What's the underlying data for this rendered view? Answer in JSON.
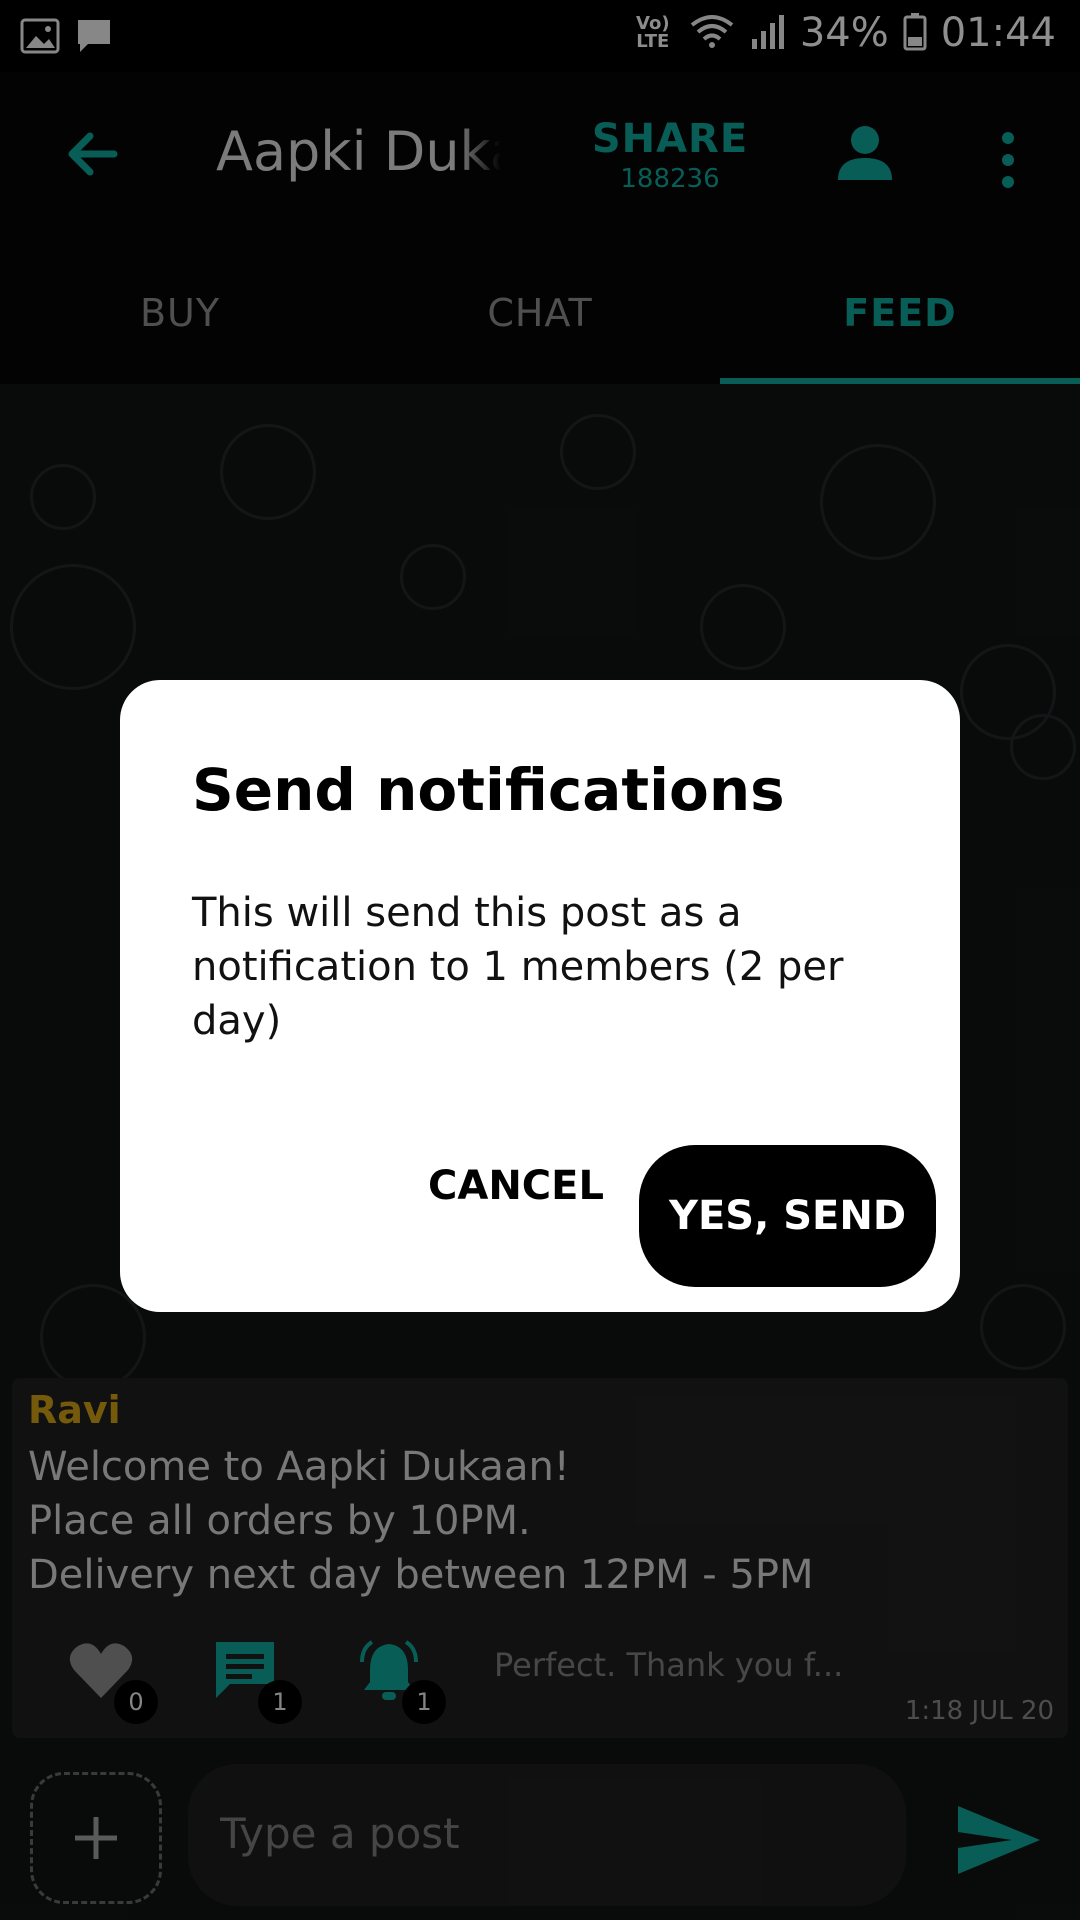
{
  "status_bar": {
    "network_label": "Vo) LTE",
    "battery": "34%",
    "time": "01:44"
  },
  "app_bar": {
    "title": "Aapki Dukaan",
    "share_label": "SHARE",
    "share_count": "188236"
  },
  "tabs": [
    {
      "label": "BUY",
      "active": false
    },
    {
      "label": "CHAT",
      "active": false
    },
    {
      "label": "FEED",
      "active": true
    }
  ],
  "post": {
    "author": "Ravi",
    "text": "Welcome to Aapki Dukaan!\nPlace all orders by 10PM.\nDelivery next day between 12PM - 5PM",
    "likes": "0",
    "comments": "1",
    "notifications": "1",
    "reply_preview": "Perfect. Thank you f...",
    "time": "1:18 JUL 20"
  },
  "composer": {
    "placeholder": "Type a post"
  },
  "dialog": {
    "title": "Send notifications",
    "body": "This will send this post as a notification to 1 members (2 per day)",
    "cancel_label": "CANCEL",
    "confirm_label": "YES, SEND"
  },
  "colors": {
    "accent": "#0d8f86",
    "author": "#b58a12",
    "background": "#000000"
  }
}
